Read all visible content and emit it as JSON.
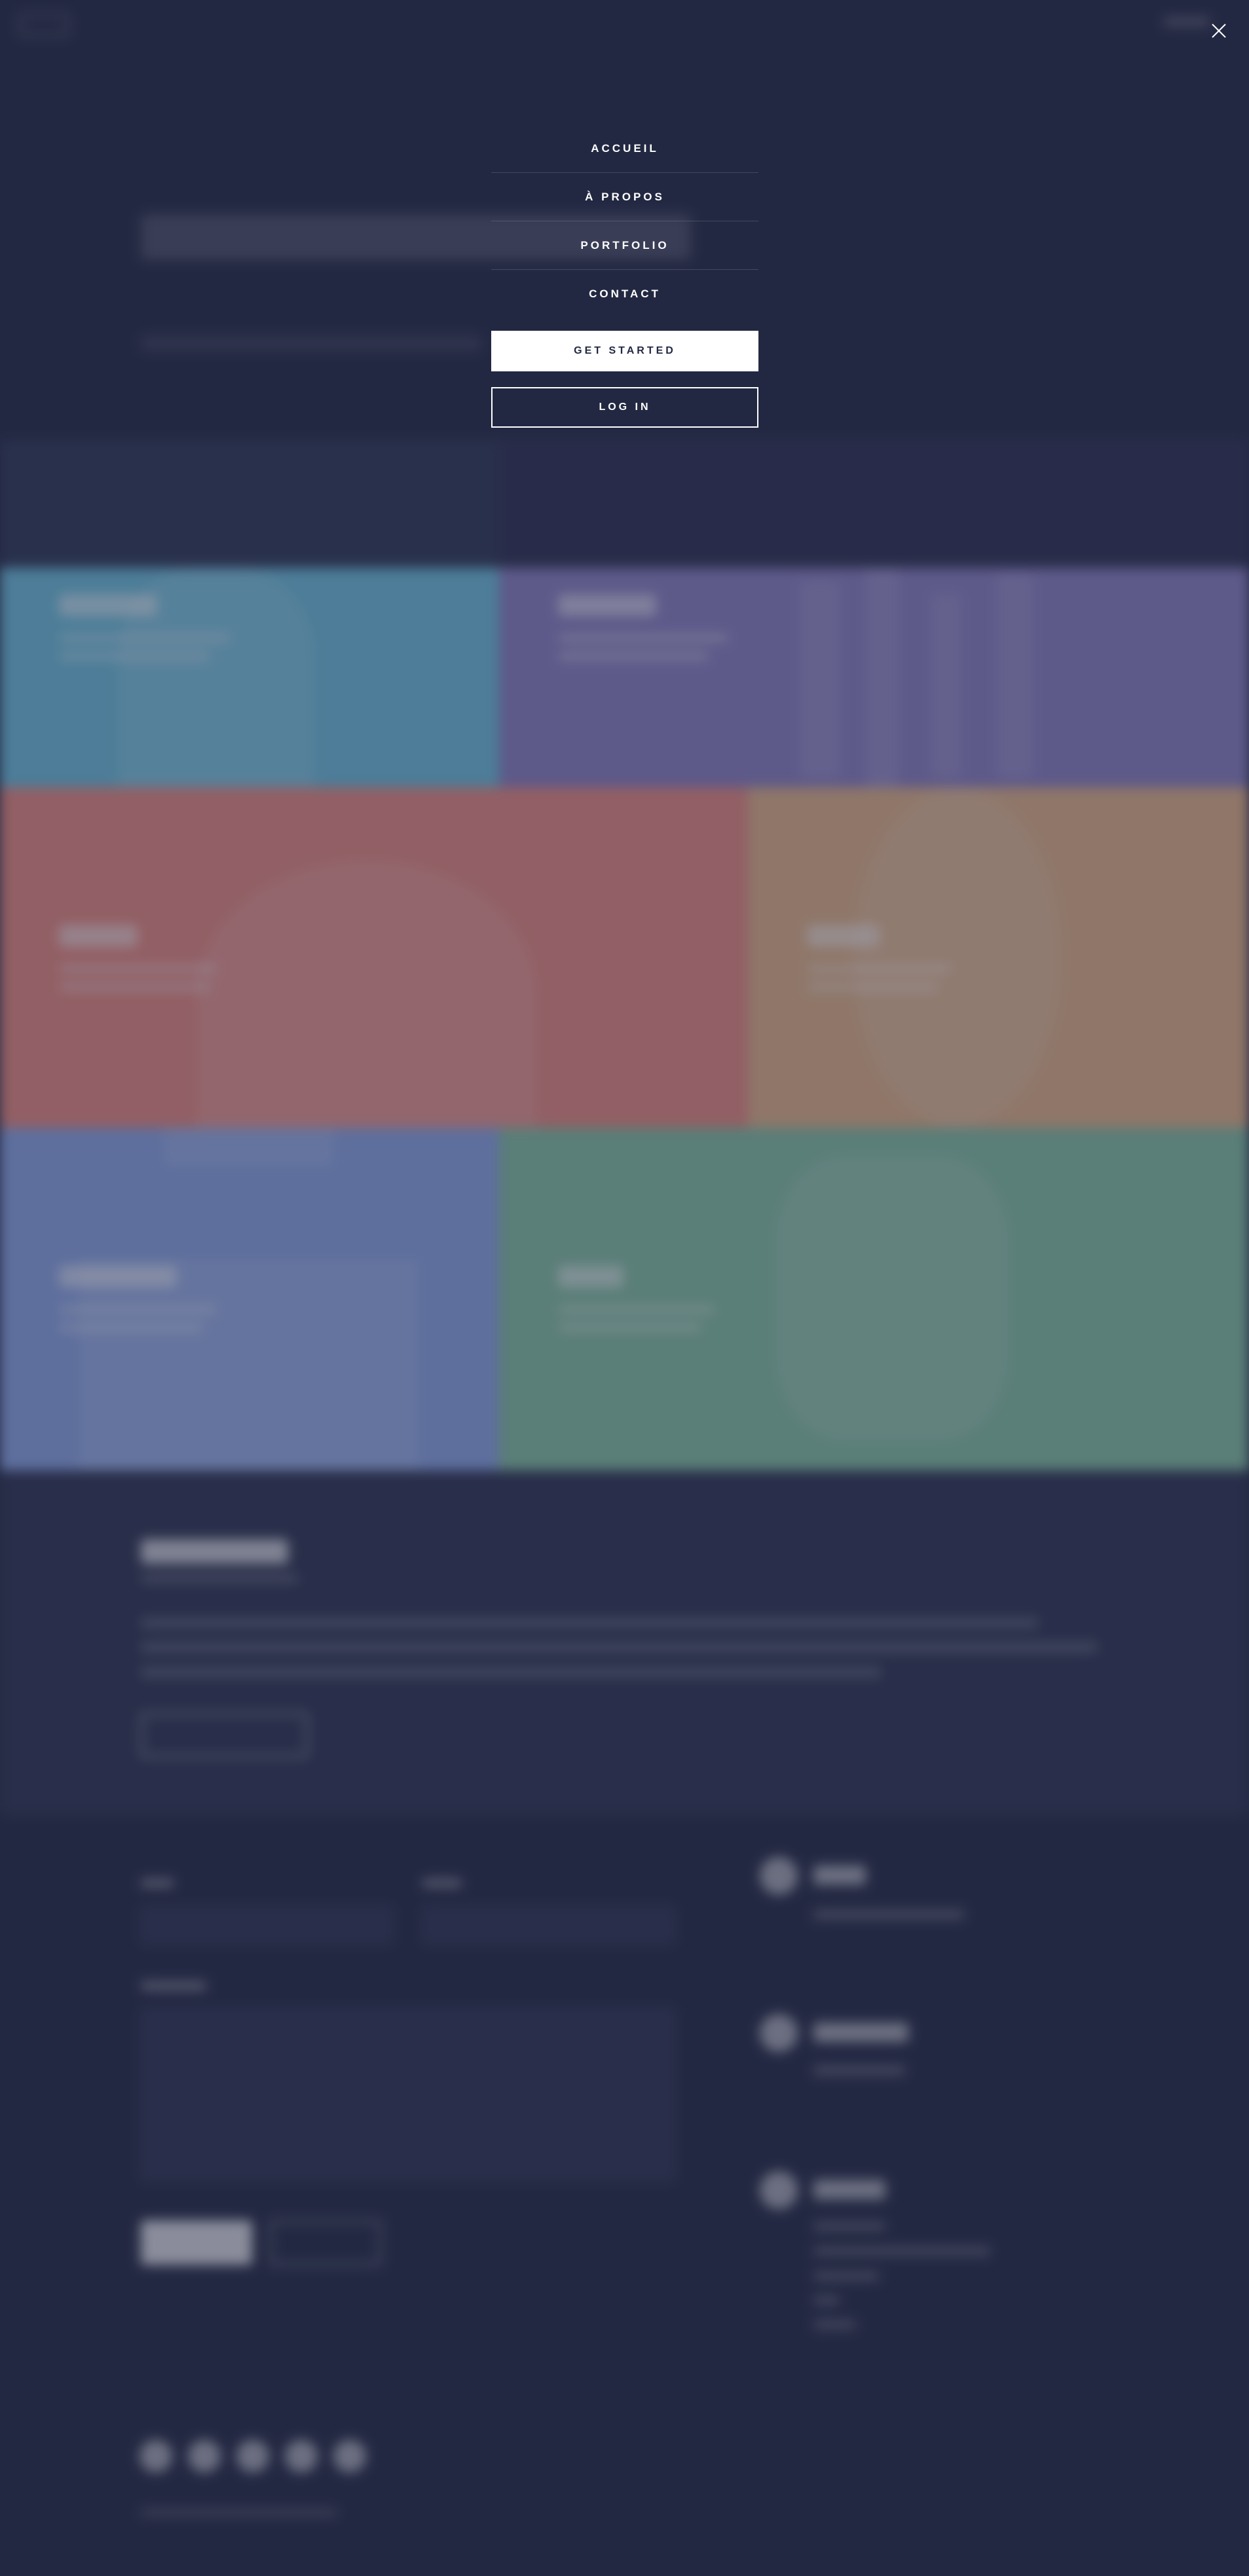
{
  "menu": {
    "items": [
      {
        "label": "ACCUEIL"
      },
      {
        "label": "À PROPOS"
      },
      {
        "label": "PORTFOLIO"
      },
      {
        "label": "CONTACT"
      }
    ],
    "primary_button": "GET STARTED",
    "secondary_button": "LOG IN"
  },
  "icons": {
    "close": "close-icon"
  },
  "colors": {
    "page_bg": "#242943",
    "tile_1": "#6fc3df",
    "tile_2": "#8d82c4",
    "tile_3": "#ec8d81",
    "tile_4": "#e7b788",
    "tile_5": "#8ea9e8",
    "tile_6": "#87c5a4"
  }
}
